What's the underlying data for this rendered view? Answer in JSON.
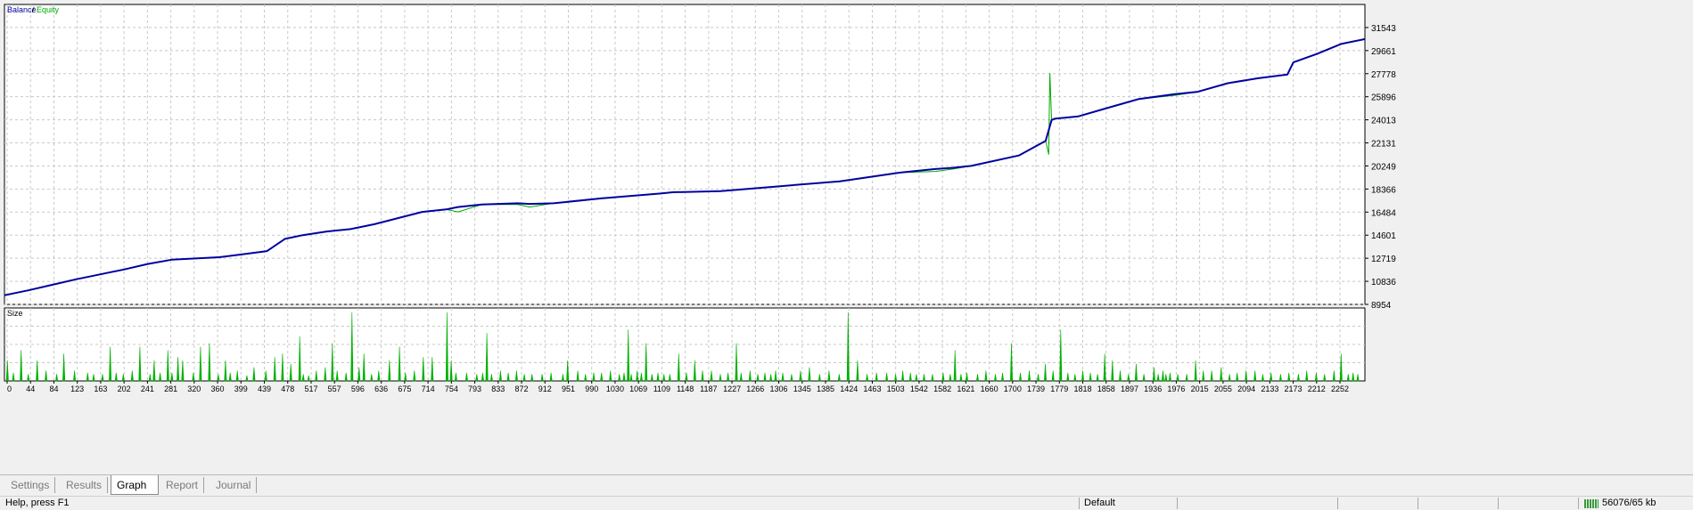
{
  "colors": {
    "balance": "#0000a0",
    "equity": "#00aa00",
    "size_bars": "#00b000",
    "grid": "#c8c8c8",
    "background": "#ffffff"
  },
  "chart_data": [
    {
      "type": "line",
      "legend": [
        "Balance",
        "Equity"
      ],
      "legend_placement": "top-left",
      "grid": true,
      "x_range": [
        0,
        2280
      ],
      "ylim": [
        8954,
        33425
      ],
      "y_ticks": [
        "31543",
        "29661",
        "27778",
        "25896",
        "24013",
        "22131",
        "20249",
        "18366",
        "16484",
        "14601",
        "12719",
        "10836",
        "8954"
      ],
      "series": [
        {
          "name": "Balance",
          "x": [
            0,
            40,
            80,
            120,
            160,
            200,
            240,
            280,
            320,
            360,
            400,
            440,
            470,
            500,
            540,
            580,
            620,
            660,
            700,
            740,
            760,
            800,
            860,
            880,
            920,
            1000,
            1100,
            1120,
            1200,
            1300,
            1400,
            1500,
            1560,
            1590,
            1620,
            1700,
            1745,
            1755,
            1760,
            1800,
            1850,
            1900,
            1960,
            2000,
            2050,
            2100,
            2150,
            2160,
            2200,
            2240,
            2280
          ],
          "y": [
            9700,
            10100,
            10550,
            11000,
            11400,
            11800,
            12250,
            12600,
            12700,
            12800,
            13050,
            13300,
            14300,
            14600,
            14900,
            15100,
            15500,
            16000,
            16500,
            16700,
            16900,
            17100,
            17200,
            17150,
            17200,
            17600,
            18000,
            18100,
            18200,
            18600,
            19000,
            19700,
            20000,
            20100,
            20250,
            21100,
            22300,
            24000,
            24100,
            24300,
            25000,
            25700,
            26100,
            26300,
            27000,
            27400,
            27700,
            28700,
            29400,
            30200,
            30600
          ]
        },
        {
          "name": "Equity",
          "x": [
            0,
            40,
            80,
            120,
            160,
            200,
            240,
            280,
            320,
            360,
            400,
            440,
            470,
            500,
            540,
            580,
            620,
            660,
            700,
            740,
            760,
            800,
            860,
            880,
            920,
            1000,
            1100,
            1120,
            1200,
            1300,
            1400,
            1500,
            1560,
            1590,
            1620,
            1700,
            1745,
            1750,
            1752,
            1755,
            1760,
            1800,
            1850,
            1900,
            1960,
            2000,
            2050,
            2100,
            2150,
            2160,
            2200,
            2240,
            2280
          ],
          "y": [
            9650,
            10100,
            10550,
            11000,
            11400,
            11800,
            12250,
            12600,
            12700,
            12800,
            13050,
            13300,
            14300,
            14600,
            14900,
            15100,
            15500,
            16000,
            16500,
            16700,
            16500,
            17100,
            17100,
            16900,
            17200,
            17600,
            18000,
            18100,
            18200,
            18600,
            19000,
            19700,
            19800,
            20000,
            20250,
            21100,
            22300,
            21200,
            27800,
            24000,
            24100,
            24300,
            25000,
            25700,
            26000,
            26300,
            27000,
            27400,
            27700,
            28700,
            29400,
            30200,
            30600
          ]
        }
      ]
    },
    {
      "type": "bar",
      "title": "Size",
      "grid": true,
      "x_ticks": [
        "0",
        "44",
        "84",
        "123",
        "163",
        "202",
        "241",
        "281",
        "320",
        "360",
        "399",
        "439",
        "478",
        "517",
        "557",
        "596",
        "636",
        "675",
        "714",
        "754",
        "793",
        "833",
        "872",
        "912",
        "951",
        "990",
        "1030",
        "1069",
        "1109",
        "1148",
        "1187",
        "1227",
        "1266",
        "1306",
        "1345",
        "1385",
        "1424",
        "1463",
        "1503",
        "1542",
        "1582",
        "1621",
        "1660",
        "1700",
        "1739",
        "1779",
        "1818",
        "1858",
        "1897",
        "1936",
        "1976",
        "2015",
        "2055",
        "2094",
        "2133",
        "2173",
        "2212",
        "2252"
      ],
      "x_range": [
        0,
        2290
      ],
      "ylim": [
        0,
        1
      ],
      "x": [
        5,
        15,
        28,
        40,
        55,
        70,
        88,
        100,
        118,
        140,
        150,
        165,
        178,
        188,
        200,
        215,
        228,
        245,
        252,
        262,
        275,
        282,
        292,
        300,
        318,
        330,
        345,
        360,
        372,
        380,
        392,
        408,
        420,
        440,
        455,
        468,
        482,
        497,
        503,
        512,
        525,
        540,
        552,
        560,
        575,
        585,
        597,
        605,
        618,
        630,
        648,
        665,
        675,
        690,
        705,
        720,
        745,
        752,
        760,
        778,
        795,
        805,
        812,
        820,
        835,
        848,
        862,
        875,
        888,
        905,
        920,
        940,
        948,
        965,
        978,
        992,
        1005,
        1020,
        1035,
        1043,
        1050,
        1055,
        1065,
        1072,
        1080,
        1090,
        1100,
        1110,
        1120,
        1135,
        1148,
        1162,
        1175,
        1190,
        1205,
        1218,
        1232,
        1240,
        1255,
        1268,
        1280,
        1290,
        1298,
        1310,
        1325,
        1340,
        1355,
        1372,
        1388,
        1405,
        1420,
        1436,
        1452,
        1468,
        1485,
        1500,
        1512,
        1525,
        1535,
        1548,
        1562,
        1580,
        1592,
        1600,
        1610,
        1620,
        1638,
        1652,
        1668,
        1680,
        1695,
        1710,
        1725,
        1740,
        1752,
        1765,
        1778,
        1790,
        1802,
        1815,
        1828,
        1840,
        1852,
        1865,
        1878,
        1892,
        1905,
        1918,
        1935,
        1942,
        1950,
        1955,
        1962,
        1975,
        1990,
        2005,
        2018,
        2032,
        2048,
        2062,
        2075,
        2090,
        2105,
        2118,
        2132,
        2148,
        2162,
        2178,
        2192,
        2208,
        2222,
        2238,
        2250,
        2262,
        2270,
        2278
      ],
      "values": [
        0.3,
        0.12,
        0.45,
        0.1,
        0.3,
        0.15,
        0.1,
        0.4,
        0.15,
        0.12,
        0.1,
        0.1,
        0.5,
        0.12,
        0.1,
        0.15,
        0.5,
        0.1,
        0.3,
        0.12,
        0.45,
        0.12,
        0.35,
        0.3,
        0.12,
        0.5,
        0.55,
        0.1,
        0.3,
        0.12,
        0.15,
        0.08,
        0.2,
        0.15,
        0.35,
        0.4,
        0.25,
        0.65,
        0.1,
        0.08,
        0.15,
        0.2,
        0.55,
        0.15,
        0.12,
        1.0,
        0.2,
        0.4,
        0.1,
        0.15,
        0.3,
        0.5,
        0.12,
        0.15,
        0.35,
        0.35,
        1.0,
        0.3,
        0.12,
        0.12,
        0.1,
        0.12,
        0.7,
        0.1,
        0.15,
        0.12,
        0.15,
        0.1,
        0.1,
        0.1,
        0.12,
        0.1,
        0.3,
        0.15,
        0.1,
        0.12,
        0.12,
        0.15,
        0.1,
        0.12,
        0.75,
        0.1,
        0.15,
        0.12,
        0.55,
        0.1,
        0.12,
        0.1,
        0.1,
        0.4,
        0.12,
        0.3,
        0.15,
        0.15,
        0.1,
        0.12,
        0.55,
        0.12,
        0.15,
        0.1,
        0.12,
        0.1,
        0.15,
        0.12,
        0.1,
        0.15,
        0.2,
        0.1,
        0.15,
        0.1,
        1.0,
        0.3,
        0.1,
        0.12,
        0.12,
        0.1,
        0.15,
        0.12,
        0.1,
        0.1,
        0.1,
        0.12,
        0.1,
        0.45,
        0.1,
        0.12,
        0.1,
        0.15,
        0.1,
        0.12,
        0.55,
        0.12,
        0.15,
        0.1,
        0.25,
        0.15,
        0.75,
        0.12,
        0.1,
        0.15,
        0.12,
        0.1,
        0.4,
        0.3,
        0.15,
        0.1,
        0.25,
        0.1,
        0.2,
        0.1,
        0.15,
        0.1,
        0.12,
        0.1,
        0.1,
        0.3,
        0.15,
        0.15,
        0.2,
        0.1,
        0.12,
        0.15,
        0.15,
        0.1,
        0.12,
        0.1,
        0.12,
        0.1,
        0.15,
        0.12,
        0.1,
        0.15,
        0.4,
        0.1,
        0.12,
        0.1,
        0.15,
        0.2,
        0.15,
        0.1,
        0.3,
        0.15,
        0.1,
        0.2,
        0.1
      ]
    }
  ],
  "tabs": [
    {
      "label": "Settings",
      "active": false
    },
    {
      "label": "Results",
      "active": false
    },
    {
      "label": "Graph",
      "active": true
    },
    {
      "label": "Report",
      "active": false
    },
    {
      "label": "Journal",
      "active": false
    }
  ],
  "status": {
    "left": "Help, press F1",
    "profile": "Default",
    "traffic": "56076/65 kb"
  }
}
